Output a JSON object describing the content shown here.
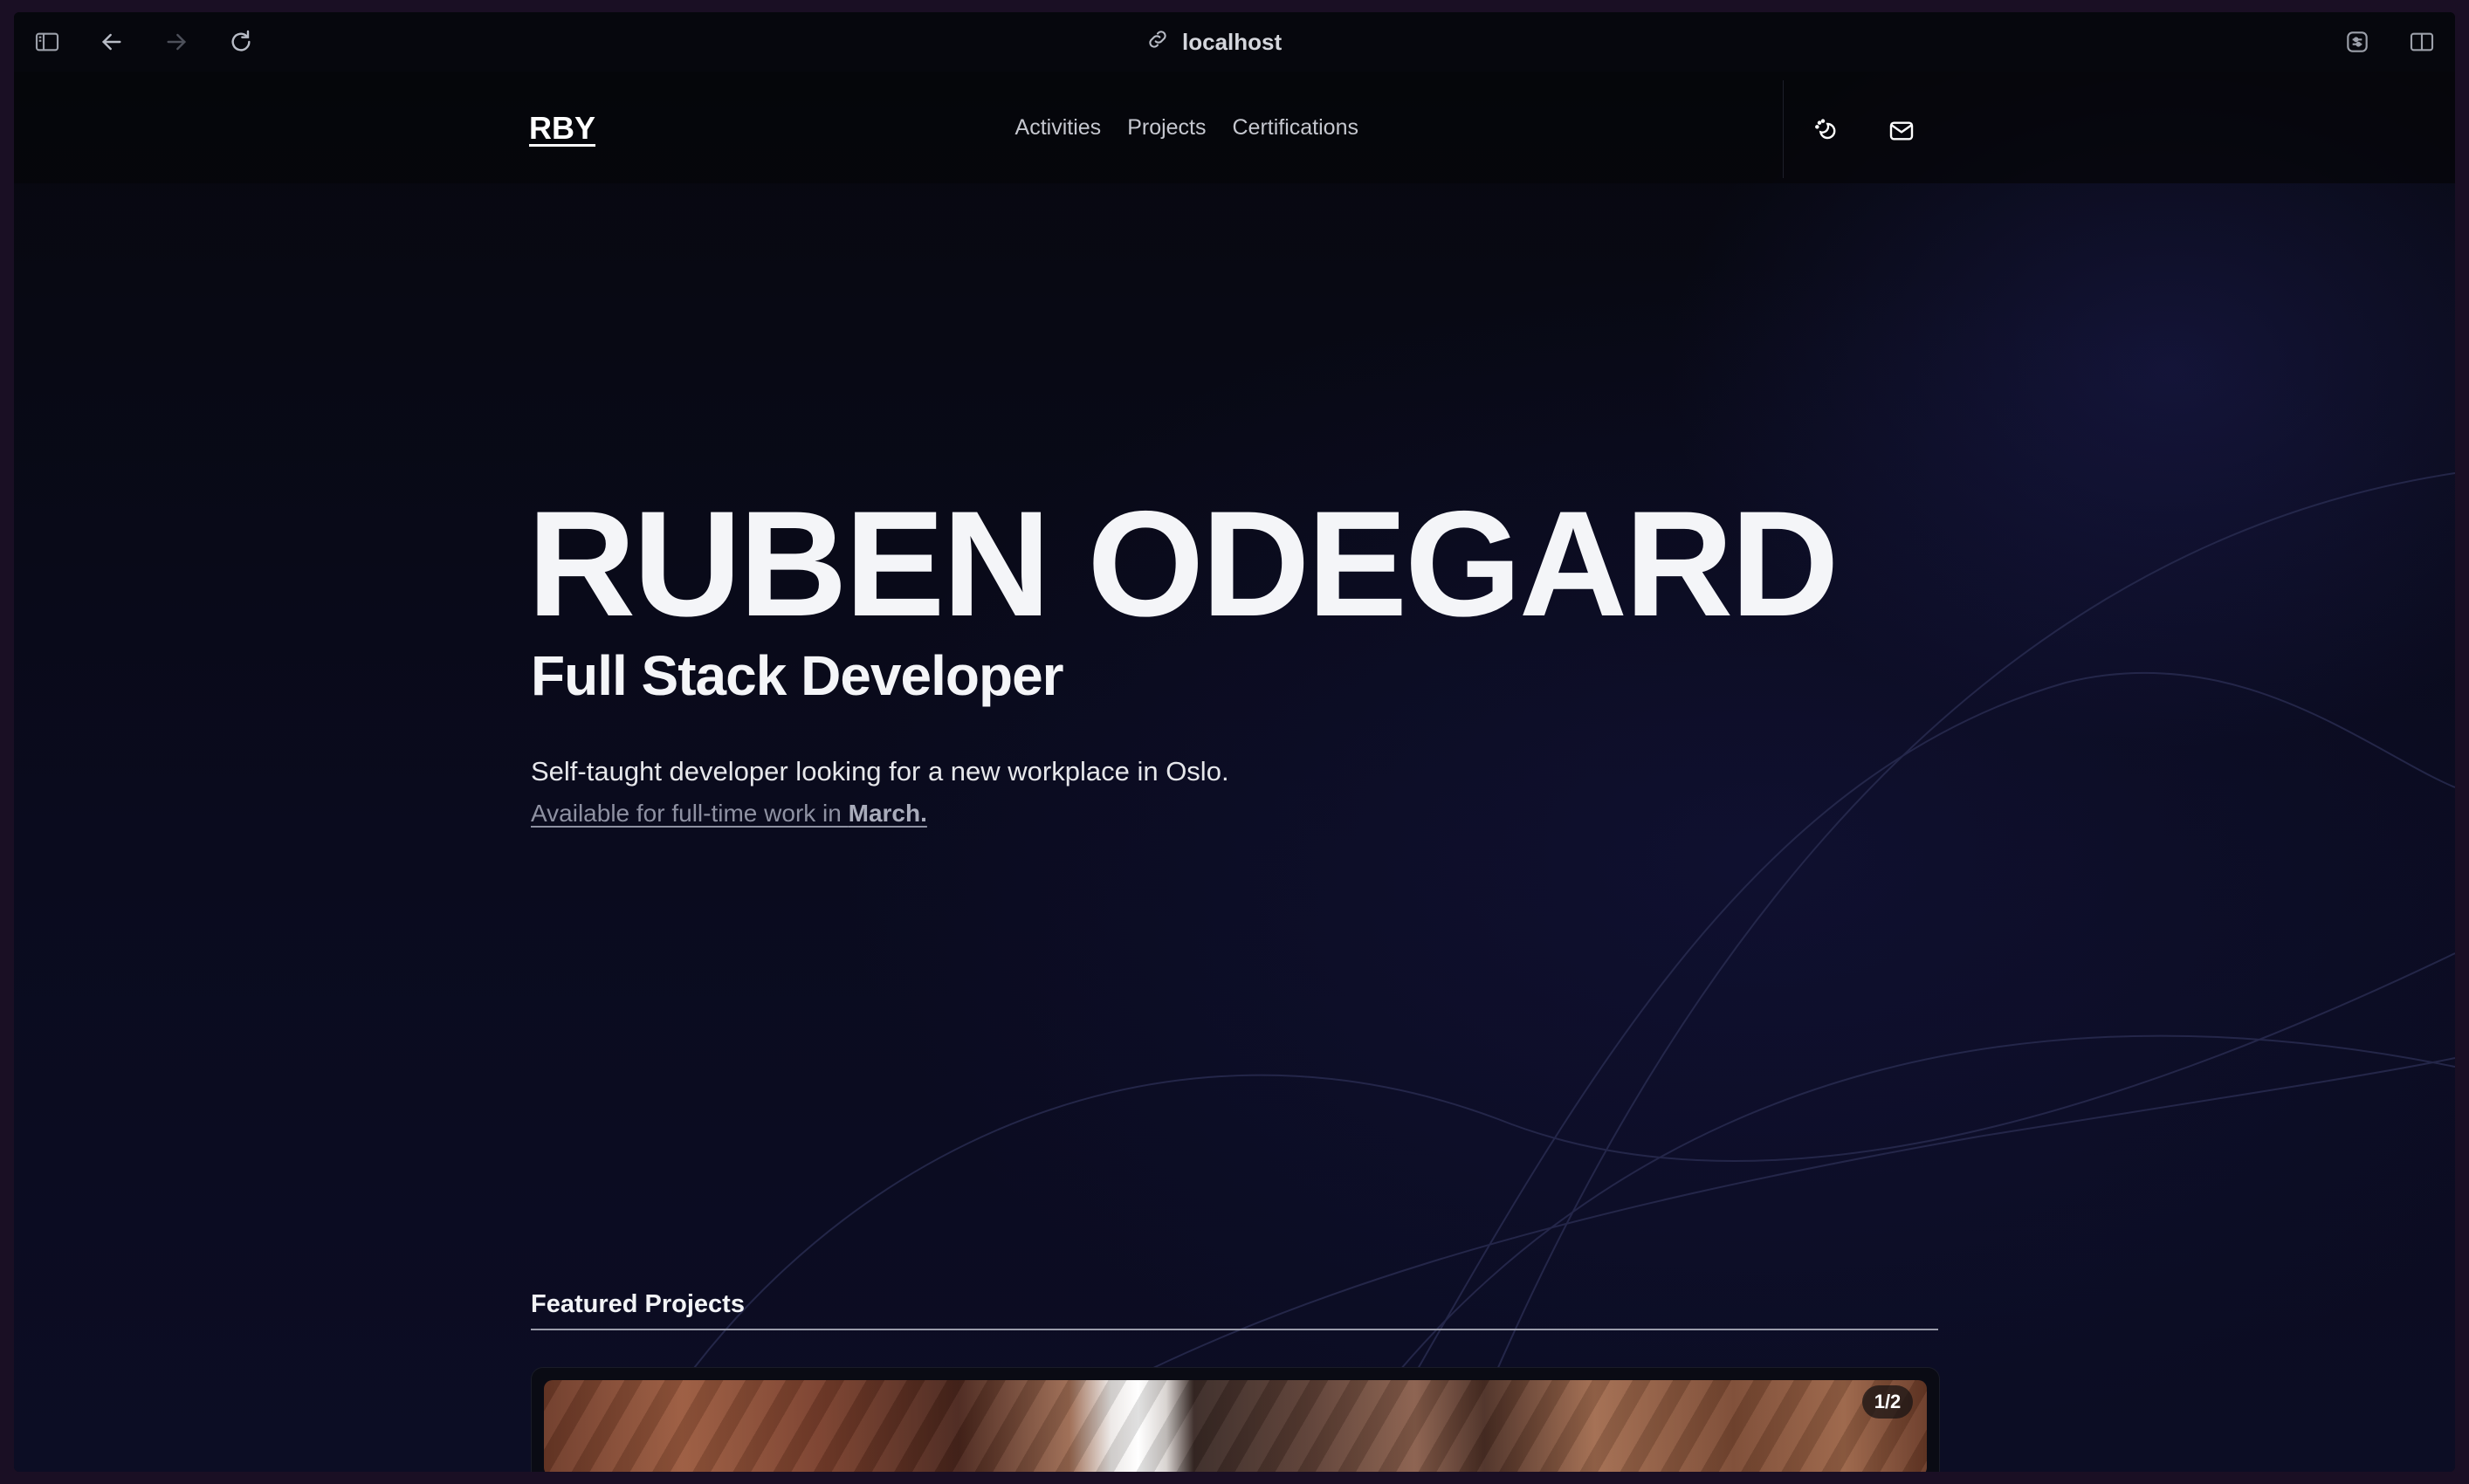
{
  "browser": {
    "url": "localhost"
  },
  "nav": {
    "logo": "RBY",
    "links": [
      {
        "label": "Activities"
      },
      {
        "label": "Projects"
      },
      {
        "label": "Certifications"
      }
    ],
    "theme_icon": "theme-toggle-icon",
    "mail_icon": "mail-icon"
  },
  "hero": {
    "name": "RUBEN ODEGARD",
    "role": "Full Stack Developer",
    "description": "Self-taught developer looking for a new workplace in Oslo.",
    "availability_prefix": "Available for full-time work in ",
    "availability_month": "March."
  },
  "featured": {
    "title": "Featured Projects",
    "counter": "1/2"
  },
  "colors": {
    "background": "#06070d",
    "text": "#f4f5f8",
    "muted": "#8e91a2"
  }
}
